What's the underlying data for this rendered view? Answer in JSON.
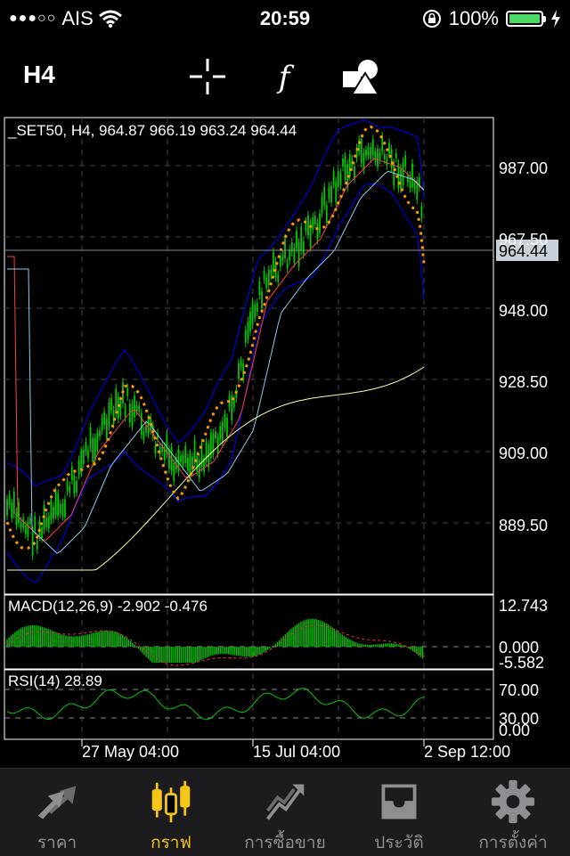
{
  "status_bar": {
    "signal_dots": "●●●○○",
    "carrier": "AIS",
    "time": "20:59",
    "battery_percent": "100%",
    "battery_level": 1.0,
    "battery_color": "#4cd964"
  },
  "toolbar": {
    "timeframe": "H4",
    "icons": [
      "crosshair-icon",
      "function-icon",
      "objects-icon"
    ]
  },
  "chart": {
    "header": "_SET50, H4, 964.87 966.19 963.24 964.44",
    "current_price": "964.44",
    "price_ticks": [
      "987.00",
      "967.50",
      "948.00",
      "928.50",
      "909.00",
      "889.50"
    ],
    "macd": {
      "label": "MACD(12,26,9) -2.902 -0.476",
      "ticks": [
        "12.743",
        "0.000",
        "-5.582"
      ]
    },
    "rsi": {
      "label": "RSI(14) 28.89",
      "ticks": [
        "70.00",
        "30.00",
        "0.00"
      ]
    },
    "time_ticks": [
      "27 May 04:00",
      "15 Jul 04:00",
      "2 Sep 12:00"
    ],
    "colors": {
      "bull": "#00c800",
      "bear": "#00c800",
      "bollinger": "#0000ff",
      "ma_fast": "#ff4040",
      "ma_mid": "#87ceeb",
      "ma_slow": "#ffff99",
      "sar": "#ff9900",
      "grid": "#444444"
    }
  },
  "tabs": [
    {
      "label": "ราคา",
      "icon": "quotes-arrows-icon",
      "active": false
    },
    {
      "label": "กราฟ",
      "icon": "candles-chart-icon",
      "active": true
    },
    {
      "label": "การซื้อขาย",
      "icon": "trade-chart-icon",
      "active": false
    },
    {
      "label": "ประวัติ",
      "icon": "history-inbox-icon",
      "active": false
    },
    {
      "label": "การตั้งค่า",
      "icon": "settings-gear-icon",
      "active": false
    }
  ],
  "accent": "#f5c518",
  "tab_inactive": "#8e8e93"
}
